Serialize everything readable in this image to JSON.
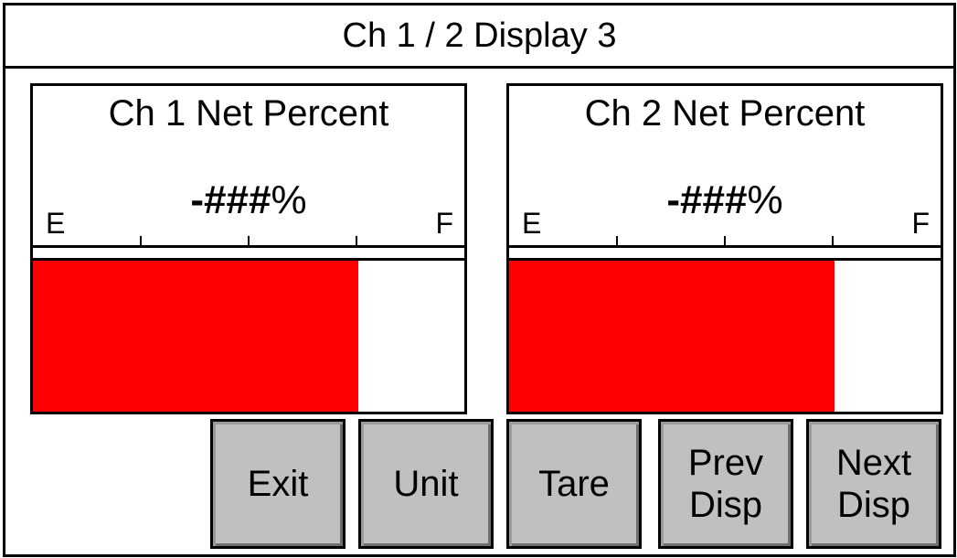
{
  "title": "Ch 1 / 2 Display 3",
  "panels": [
    {
      "title": "Ch 1 Net Percent",
      "value_prefix": "-",
      "value_hash": "###",
      "value_suffix": "%",
      "scale_low": "E",
      "scale_high": "F",
      "fill_fraction": 0.755,
      "fill_color": "#ff0000"
    },
    {
      "title": "Ch 2 Net Percent",
      "value_prefix": "-",
      "value_hash": "###",
      "value_suffix": "%",
      "scale_low": "E",
      "scale_high": "F",
      "fill_fraction": 0.755,
      "fill_color": "#ff0000"
    }
  ],
  "buttons": {
    "exit": {
      "line1": "Exit"
    },
    "unit": {
      "line1": "Unit"
    },
    "tare": {
      "line1": "Tare"
    },
    "prev": {
      "line1": "Prev",
      "line2": "Disp"
    },
    "next": {
      "line1": "Next",
      "line2": "Disp"
    }
  },
  "colors": {
    "bar_fill": "#ff0000",
    "button_bg": "#c0c0c0"
  }
}
